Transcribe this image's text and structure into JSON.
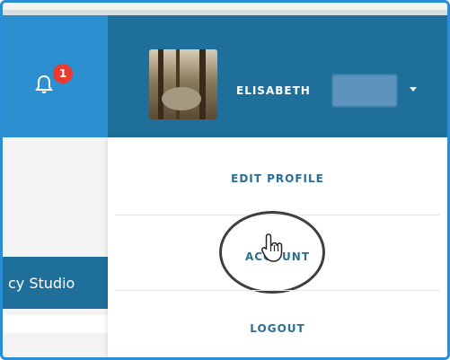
{
  "notifications": {
    "count": "1",
    "icon": "bell-icon"
  },
  "user": {
    "name": "ELISABETH",
    "menu_icon": "chevron-down-icon"
  },
  "sidebar": {
    "studio_label": "cy Studio"
  },
  "dropdown": {
    "items": [
      {
        "label": "EDIT PROFILE"
      },
      {
        "label": "ACCOUNT"
      },
      {
        "label": "LOGOUT"
      }
    ]
  },
  "colors": {
    "accent_blue": "#2c8fd0",
    "header_blue": "#1e6f99",
    "menu_text": "#2a6e93",
    "badge_red": "#e73c2e"
  }
}
